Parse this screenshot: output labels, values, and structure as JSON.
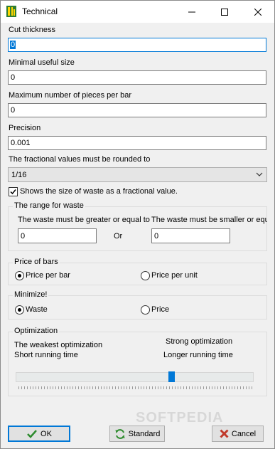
{
  "window": {
    "title": "Technical"
  },
  "fields": {
    "cut_thickness": {
      "label": "Cut thickness",
      "value": "0"
    },
    "minimal_useful_size": {
      "label": "Minimal useful size",
      "value": "0"
    },
    "max_pieces": {
      "label": "Maximum number of pieces per bar",
      "value": "0"
    },
    "precision": {
      "label": "Precision",
      "value": "0.001"
    }
  },
  "rounding": {
    "label": "The fractional values must be rounded to",
    "selected": "1/16"
  },
  "show_waste": {
    "label": "Shows the size of waste as a fractional value.",
    "checked": true
  },
  "waste_range": {
    "title": "The range for waste",
    "greater_label": "The waste must be greater or equal to",
    "smaller_label": "The waste must be smaller or equa",
    "greater_value": "0",
    "smaller_value": "0",
    "or_text": "Or"
  },
  "price_of_bars": {
    "title": "Price of bars",
    "options": [
      "Price per bar",
      "Price per unit"
    ],
    "selected": "Price per bar"
  },
  "minimize": {
    "title": "Minimize!",
    "options": [
      "Waste",
      "Price"
    ],
    "selected": "Waste"
  },
  "optimization": {
    "title": "Optimization",
    "left_line1": "The weakest optimization",
    "left_line2": "Short running time",
    "right_line1": "Strong optimization",
    "right_line2": "Longer running time",
    "slider_position": 0.66
  },
  "buttons": {
    "ok": "OK",
    "standard": "Standard",
    "cancel": "Cancel"
  },
  "watermark": "SOFTPEDIA",
  "colors": {
    "accent": "#0078d7",
    "cancel_icon": "#c0392b",
    "ok_icon": "#2e8b2e",
    "standard_icon": "#2e8b2e"
  }
}
